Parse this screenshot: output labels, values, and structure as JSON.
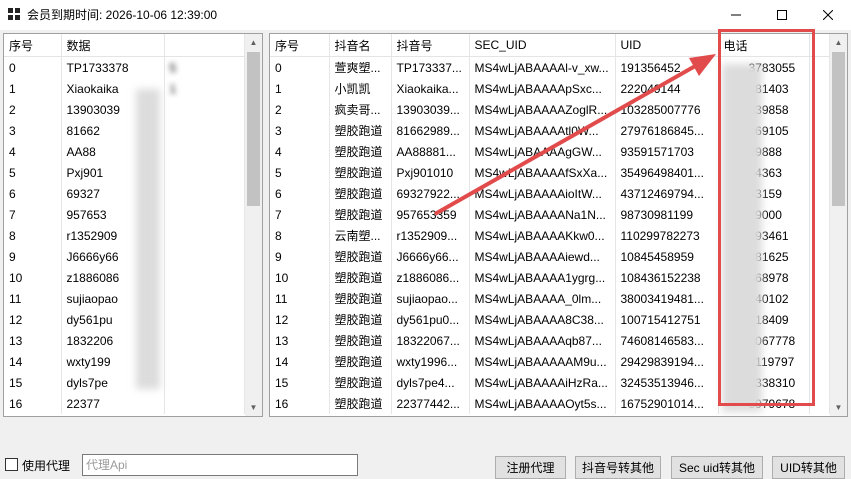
{
  "window": {
    "title": "会员到期时间: 2026-10-06 12:39:00",
    "minimize": "—",
    "maximize": "☐",
    "close": "✕"
  },
  "left_table": {
    "columns": [
      "序号",
      "数据"
    ],
    "rows": [
      [
        "0",
        "TP1733378",
        "5"
      ],
      [
        "1",
        "Xiaokaika",
        "1"
      ],
      [
        "2",
        "13903039",
        ""
      ],
      [
        "3",
        "81662",
        ""
      ],
      [
        "4",
        "AA88",
        ""
      ],
      [
        "5",
        "Pxj901",
        ""
      ],
      [
        "6",
        "69327",
        ""
      ],
      [
        "7",
        "957653",
        ""
      ],
      [
        "8",
        "r1352909",
        ""
      ],
      [
        "9",
        "J6666y66",
        ""
      ],
      [
        "10",
        "z1886086",
        ""
      ],
      [
        "11",
        "sujiaopao",
        ""
      ],
      [
        "12",
        "dy561pu",
        ""
      ],
      [
        "13",
        "1832206",
        ""
      ],
      [
        "14",
        "wxty199",
        ""
      ],
      [
        "15",
        "dyls7pe",
        ""
      ],
      [
        "16",
        "22377",
        ""
      ]
    ]
  },
  "right_table": {
    "columns": [
      "序号",
      "抖音名",
      "抖音号",
      "SEC_UID",
      "UID",
      "电话"
    ],
    "rows": [
      {
        "idx": "0",
        "name": "萱爽塑...",
        "dyid": "TP173337...",
        "secuid": "MS4wLjABAAAAl-v_xw...",
        "uid": "191356452",
        "phone": "3783055"
      },
      {
        "idx": "1",
        "name": "小凯凯",
        "dyid": "Xiaokaika...",
        "secuid": "MS4wLjABAAAApSxc...",
        "uid": "222049144",
        "phone": "381403"
      },
      {
        "idx": "2",
        "name": "疯卖哥...",
        "dyid": "13903039...",
        "secuid": "MS4wLjABAAAAZoglR...",
        "uid": "103285007776",
        "phone": "039858"
      },
      {
        "idx": "3",
        "name": "塑胶跑道",
        "dyid": "81662989...",
        "secuid": "MS4wLjABAAAAtl0W...",
        "uid": "27976186845...",
        "phone": "369105"
      },
      {
        "idx": "4",
        "name": "塑胶跑道",
        "dyid": "AA88881...",
        "secuid": "MS4wLjABAAAAgGW...",
        "uid": "93591571703",
        "phone": "29888"
      },
      {
        "idx": "5",
        "name": "塑胶跑道",
        "dyid": "Pxj901010",
        "secuid": "MS4wLjABAAAAfSxXa...",
        "uid": "35496498401...",
        "phone": "44363"
      },
      {
        "idx": "6",
        "name": "塑胶跑道",
        "dyid": "69327922...",
        "secuid": "MS4wLjABAAAAioItW...",
        "uid": "43712469794...",
        "phone": "03159"
      },
      {
        "idx": "7",
        "name": "塑胶跑道",
        "dyid": "957653359",
        "secuid": "MS4wLjABAAAANa1N...",
        "uid": "98730981199",
        "phone": "29000"
      },
      {
        "idx": "8",
        "name": "云南塑...",
        "dyid": "r1352909...",
        "secuid": "MS4wLjABAAAAKkw0...",
        "uid": "110299782273",
        "phone": "093461"
      },
      {
        "idx": "9",
        "name": "塑胶跑道",
        "dyid": "J6666y66...",
        "secuid": "MS4wLjABAAAAiewd...",
        "uid": "10845458959",
        "phone": "081625"
      },
      {
        "idx": "10",
        "name": "塑胶跑道",
        "dyid": "z1886086...",
        "secuid": "MS4wLjABAAAA1ygrg...",
        "uid": "108436152238",
        "phone": "868978"
      },
      {
        "idx": "11",
        "name": "塑胶跑道",
        "dyid": "sujiaopao...",
        "secuid": "MS4wLjABAAAA_0lm...",
        "uid": "38003419481...",
        "phone": "740102"
      },
      {
        "idx": "12",
        "name": "塑胶跑道",
        "dyid": "dy561pu0...",
        "secuid": "MS4wLjABAAAA8C38...",
        "uid": "100715412751",
        "phone": "718409"
      },
      {
        "idx": "13",
        "name": "塑胶跑道",
        "dyid": "18322067...",
        "secuid": "MS4wLjABAAAAqb87...",
        "uid": "74608146583...",
        "phone": "2067778"
      },
      {
        "idx": "14",
        "name": "塑胶跑道",
        "dyid": "wxty1996...",
        "secuid": "MS4wLjABAAAAAM9u...",
        "uid": "29429839194...",
        "phone": "5119797"
      },
      {
        "idx": "15",
        "name": "塑胶跑道",
        "dyid": "dyls7pe4...",
        "secuid": "MS4wLjABAAAAiHzRa...",
        "uid": "32453513946...",
        "phone": "9338310"
      },
      {
        "idx": "16",
        "name": "塑胶跑道",
        "dyid": "22377442...",
        "secuid": "MS4wLjABAAAAOyt5s...",
        "uid": "16752901014...",
        "phone": "5979678"
      }
    ]
  },
  "bottom": {
    "use_proxy_label": "使用代理",
    "proxy_placeholder": "代理Api",
    "buttons": [
      "注册代理",
      "抖音号转其他",
      "Sec uid转其他",
      "UID转其他"
    ]
  },
  "colors": {
    "highlight": "#e14b4b",
    "window_bg": "#f0f0f0",
    "grid_bg": "#ffffff"
  }
}
